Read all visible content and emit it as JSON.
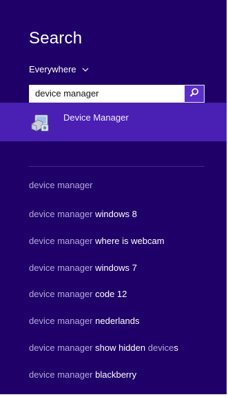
{
  "pane": {
    "title": "Search",
    "scope_label": "Everywhere",
    "query": "device manager",
    "accent": "#5b2fc7",
    "background": "#1f0068"
  },
  "top_result": {
    "label": "Device Manager",
    "icon": "device-manager-icon"
  },
  "suggestions": [
    {
      "prefix": "device manager",
      "rest": ""
    },
    {
      "prefix": "device manager ",
      "rest": "windows 8"
    },
    {
      "prefix": "device manager ",
      "rest": "where is webcam"
    },
    {
      "prefix": "device manager ",
      "rest": "windows 7"
    },
    {
      "prefix": "device manager ",
      "rest": "code 12"
    },
    {
      "prefix": "device manager ",
      "rest": "nederlands"
    },
    {
      "prefix": "device manager ",
      "rest": "show hidden",
      "mid": " device",
      "end": "s"
    },
    {
      "prefix": "device manager ",
      "rest": "blackberry"
    }
  ]
}
